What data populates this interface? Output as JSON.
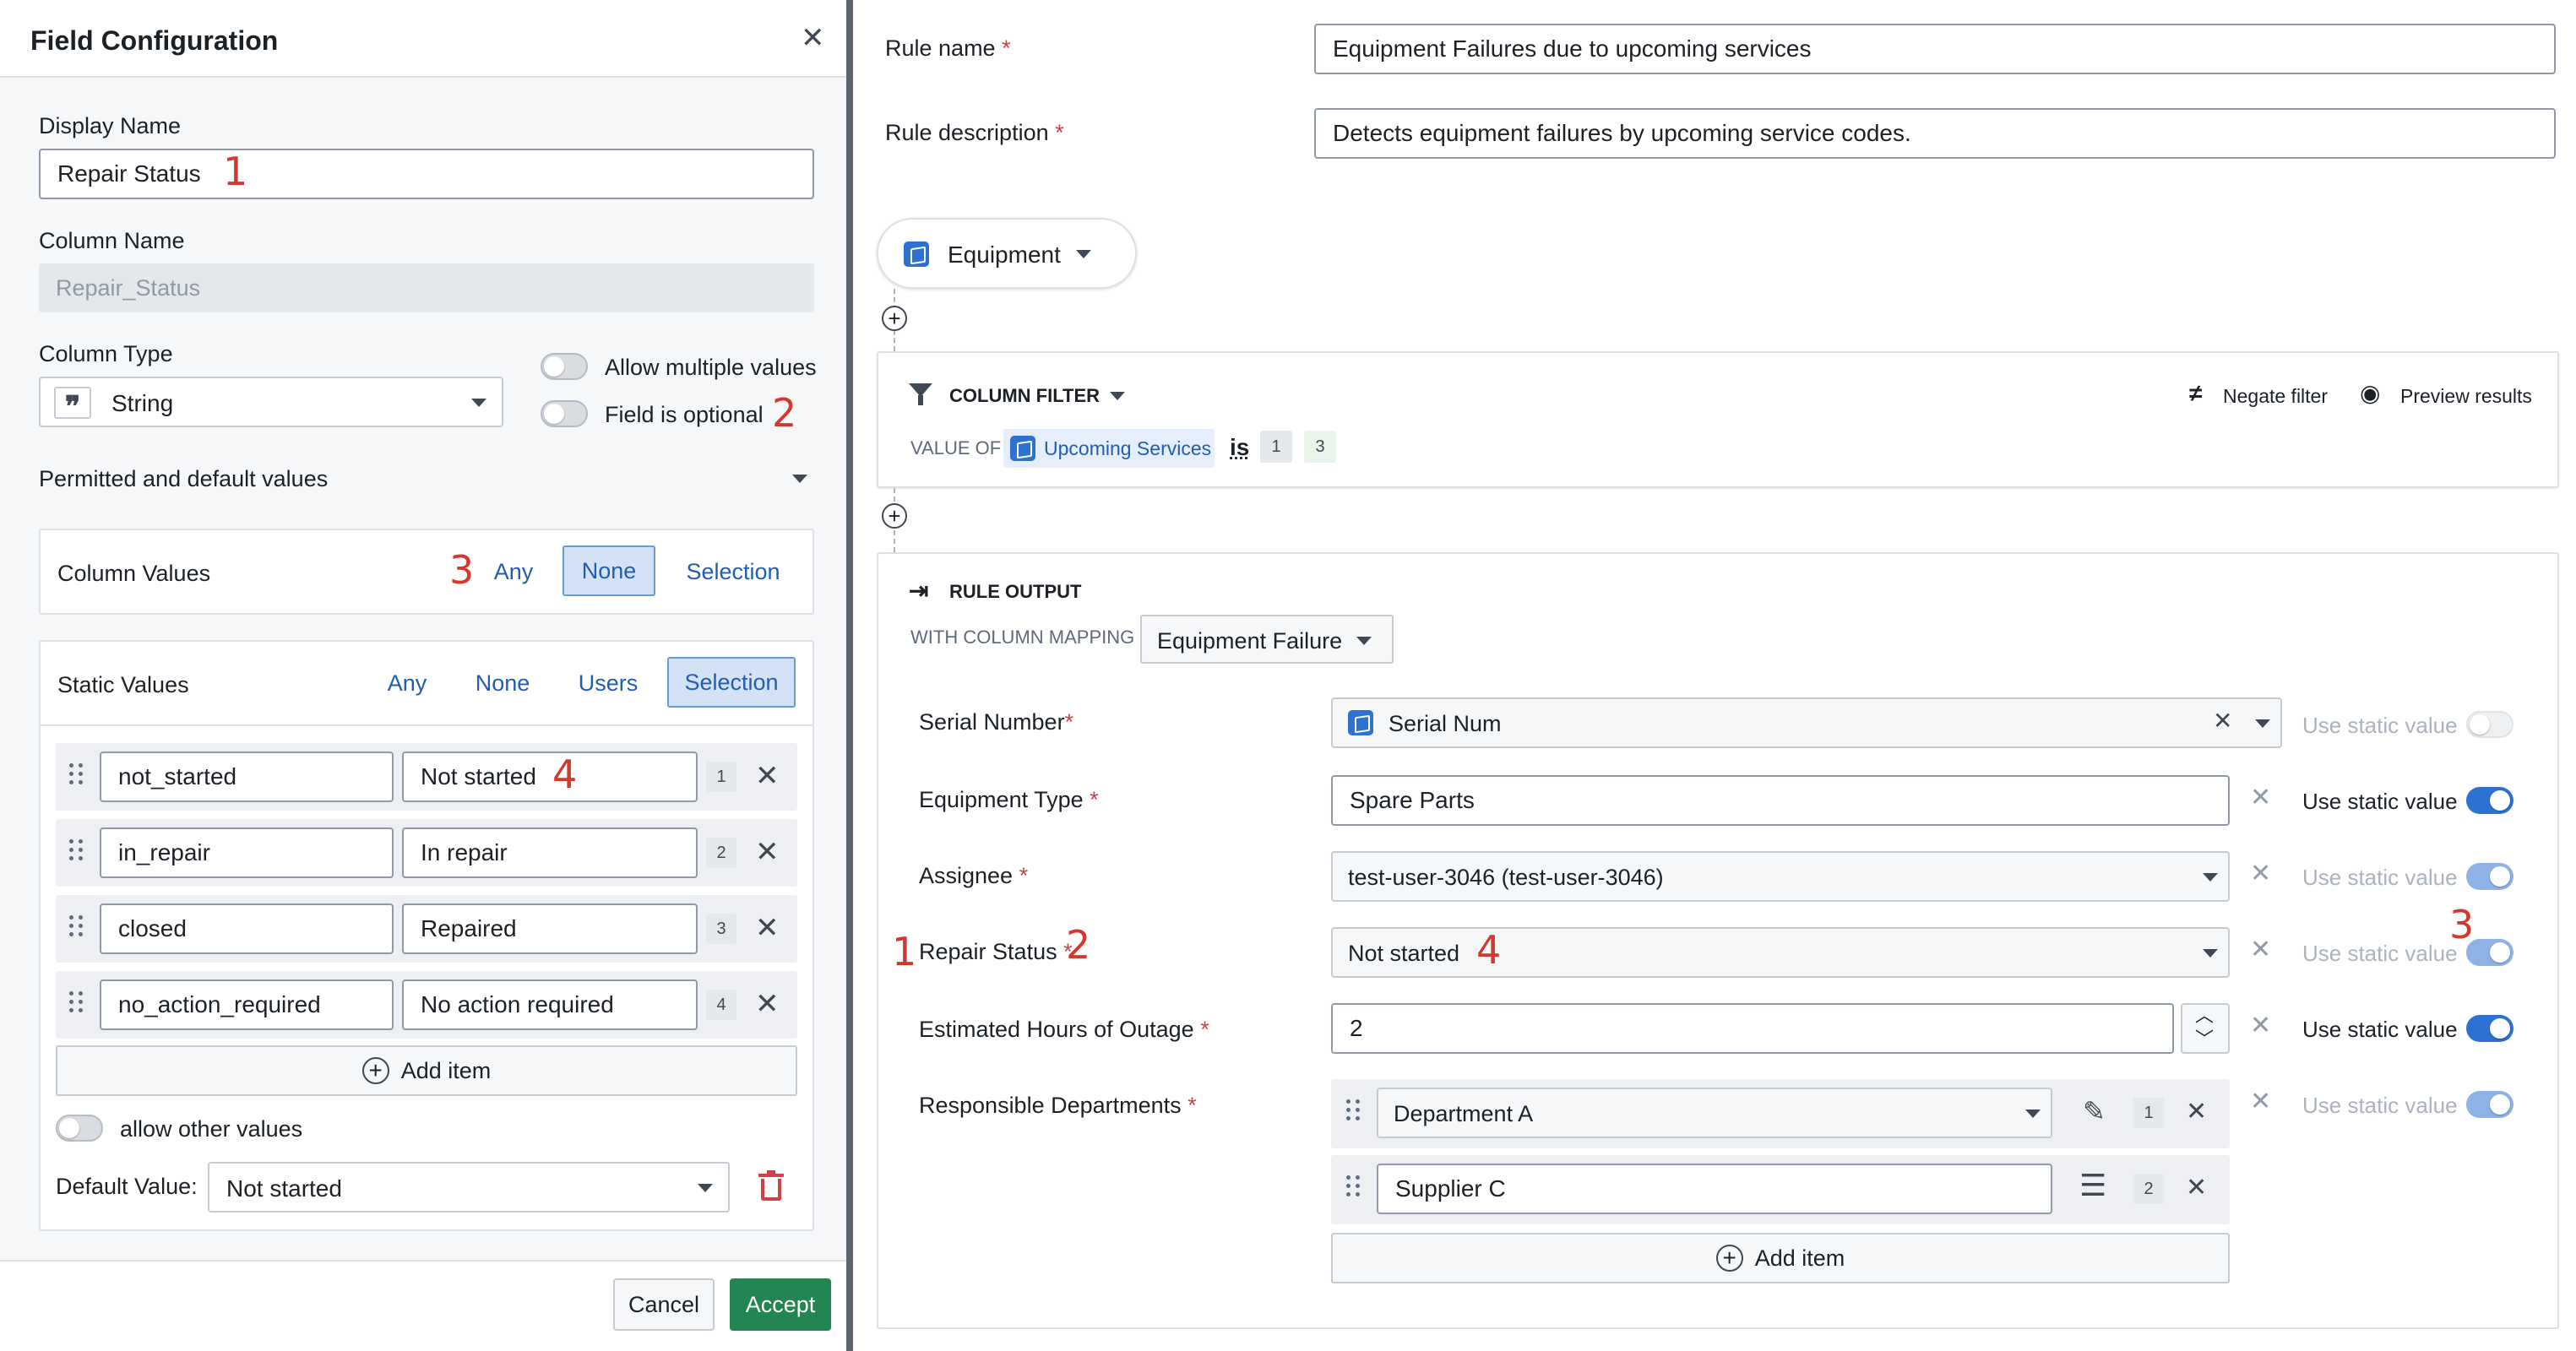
{
  "dialog": {
    "title": "Field Configuration",
    "display_name_label": "Display Name",
    "display_name_value": "Repair Status",
    "column_name_label": "Column Name",
    "column_name_value": "Repair_Status",
    "column_type_label": "Column Type",
    "column_type_value": "String",
    "allow_multiple_label": "Allow multiple values",
    "field_optional_label": "Field is optional",
    "permitted_label": "Permitted and default values",
    "column_values": {
      "label": "Column Values",
      "options": [
        "Any",
        "None",
        "Selection"
      ],
      "selected": "None"
    },
    "static_values": {
      "label": "Static Values",
      "options": [
        "Any",
        "None",
        "Users",
        "Selection"
      ],
      "selected": "Selection",
      "rows": [
        {
          "key": "not_started",
          "display": "Not started",
          "index": "1"
        },
        {
          "key": "in_repair",
          "display": "In repair",
          "index": "2"
        },
        {
          "key": "closed",
          "display": "Repaired",
          "index": "3"
        },
        {
          "key": "no_action_required",
          "display": "No action required",
          "index": "4"
        }
      ],
      "add_item": "Add item",
      "allow_other": "allow other values",
      "default_label": "Default Value:",
      "default_value": "Not started"
    },
    "cancel": "Cancel",
    "accept": "Accept"
  },
  "rule": {
    "name_label": "Rule name",
    "name_value": "Equipment Failures due to upcoming services",
    "desc_label": "Rule description",
    "desc_value": "Detects equipment failures by upcoming service codes.",
    "object_type": "Equipment",
    "filter": {
      "title": "COLUMN FILTER",
      "negate": "Negate filter",
      "preview": "Preview results",
      "value_of": "VALUE OF",
      "property": "Upcoming Services",
      "op": "is",
      "values": [
        "1",
        "3"
      ]
    },
    "output": {
      "title": "RULE OUTPUT",
      "mapping_label": "WITH COLUMN MAPPING",
      "mapping_value": "Equipment Failure",
      "static_label": "Use static value",
      "fields": [
        {
          "label": "Serial Number",
          "value": "Serial Num"
        },
        {
          "label": "Equipment Type",
          "value": "Spare Parts"
        },
        {
          "label": "Assignee",
          "value": "test-user-3046 (test-user-3046)"
        },
        {
          "label": "Repair Status",
          "value": "Not started"
        },
        {
          "label": "Estimated Hours of Outage",
          "value": "2"
        },
        {
          "label": "Responsible Departments",
          "values": [
            "Department A",
            "Supplier C"
          ],
          "indexes": [
            "1",
            "2"
          ]
        }
      ],
      "add_item": "Add item"
    }
  },
  "annotations": {
    "one": "1",
    "two": "2",
    "three": "3",
    "four": "4"
  },
  "colors": {
    "accent": "#2d72d2",
    "accept_green": "#238551",
    "annotation_red": "#d2382e"
  }
}
